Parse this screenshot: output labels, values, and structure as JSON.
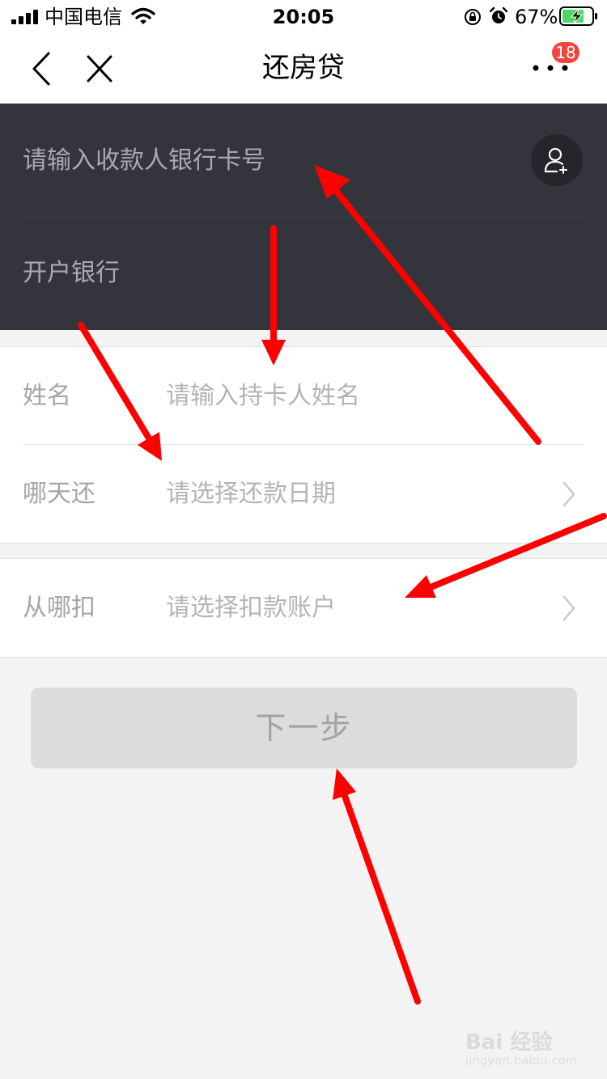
{
  "status_bar": {
    "carrier": "中国电信",
    "time": "20:05",
    "battery_percent": "67%"
  },
  "nav": {
    "title": "还房贷",
    "badge_count": "18"
  },
  "card": {
    "account_placeholder": "请输入收款人银行卡号",
    "bank_label": "开户银行"
  },
  "form": {
    "name_label": "姓名",
    "name_placeholder": "请输入持卡人姓名",
    "date_label": "哪天还",
    "date_placeholder": "请选择还款日期",
    "account_label": "从哪扣",
    "account_placeholder": "请选择扣款账户"
  },
  "next_button_label": "下一步",
  "watermark": {
    "main": "Bai 经验",
    "sub": "jingyan.baidu.com"
  },
  "colors": {
    "card_bg": "#34343c",
    "badge": "#f2453d",
    "annotation_arrow": "#ff0000",
    "button_bg": "#dddcdc"
  }
}
